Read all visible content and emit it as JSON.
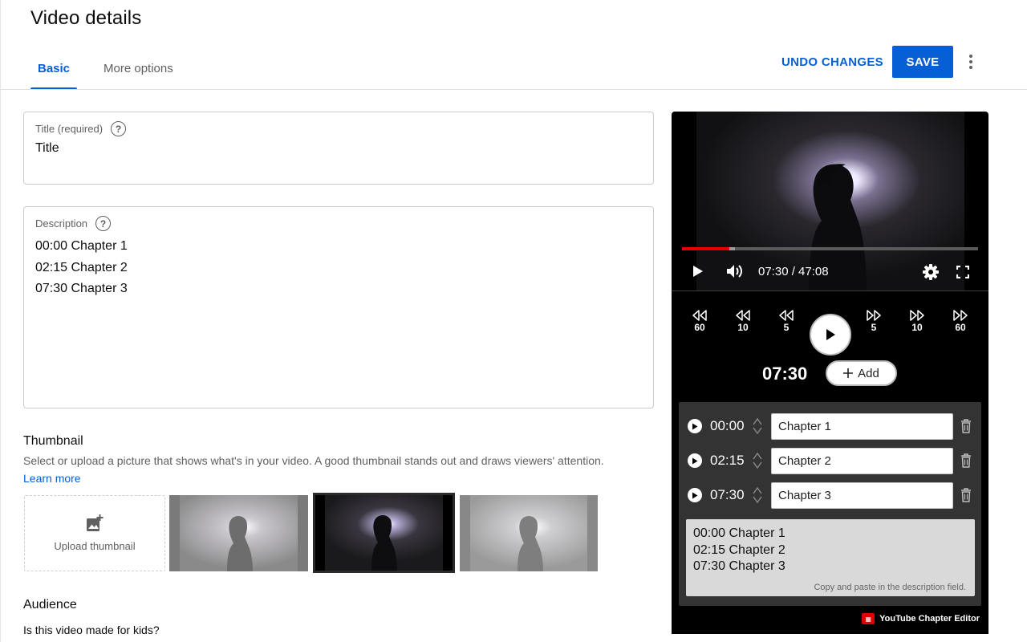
{
  "header": {
    "title": "Video details",
    "tabs": [
      {
        "label": "Basic",
        "active": true
      },
      {
        "label": "More options",
        "active": false
      }
    ],
    "undo_label": "UNDO CHANGES",
    "save_label": "SAVE",
    "more_icon": "more-vert-icon"
  },
  "colors": {
    "accent": "#065fd4",
    "progress": "#e60000",
    "panel": "#000000"
  },
  "title_field": {
    "label": "Title (required)",
    "value": "Title",
    "help_icon": "help-circle-icon"
  },
  "description_field": {
    "label": "Description",
    "lines": [
      "00:00 Chapter 1",
      "02:15 Chapter 2",
      "07:30 Chapter 3"
    ],
    "help_icon": "help-circle-icon"
  },
  "thumbnail": {
    "heading": "Thumbnail",
    "subtext": "Select or upload a picture that shows what's in your video. A good thumbnail stands out and draws viewers' attention.",
    "learn_more": "Learn more",
    "upload_label": "Upload thumbnail",
    "selected_index": 1
  },
  "audience": {
    "heading": "Audience",
    "question": "Is this video made for kids?"
  },
  "player": {
    "time_display": "07:30 / 47:08",
    "progress_fraction": 0.159,
    "buffer_fraction": 0.18
  },
  "chapter_editor": {
    "seek_back": [
      "60",
      "10",
      "5"
    ],
    "seek_forward": [
      "5",
      "10",
      "60"
    ],
    "current_time": "07:30",
    "add_label": "Add",
    "chapters": [
      {
        "time": "00:00",
        "name": "Chapter 1"
      },
      {
        "time": "02:15",
        "name": "Chapter 2"
      },
      {
        "time": "07:30",
        "name": "Chapter 3"
      }
    ],
    "output_lines": [
      "00:00 Chapter 1",
      "02:15 Chapter 2",
      "07:30 Chapter 3"
    ],
    "output_hint": "Copy and paste in the description field.",
    "brand": "YouTube Chapter Editor"
  }
}
